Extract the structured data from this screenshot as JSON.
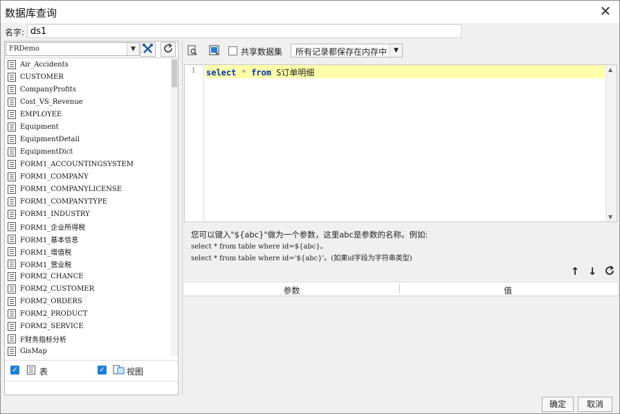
{
  "window": {
    "title": "数据库查询",
    "close_glyph": "✕"
  },
  "name_field": {
    "label": "名字:",
    "value": "ds1"
  },
  "left_panel": {
    "connection": "FRDemo",
    "tables": [
      "Air_Accidents",
      "CUSTOMER",
      "CompanyProfits",
      "Cost_VS_Revenue",
      "EMPLOYEE",
      "Equipment",
      "EquipmentDetail",
      "EquipmentDict",
      "FORM1_ACCOUNTINGSYSTEM",
      "FORM1_COMPANY",
      "FORM1_COMPANYLICENSE",
      "FORM1_COMPANYTYPE",
      "FORM1_INDUSTRY",
      "FORM1_企业所得税",
      "FORM1_基本信息",
      "FORM1_增值税",
      "FORM1_营业税",
      "FORM2_CHANCE",
      "FORM2_CUSTOMER",
      "FORM2_ORDERS",
      "FORM2_PRODUCT",
      "FORM2_SERVICE",
      "F财务指标分析",
      "GisMap"
    ],
    "filter_table_label": "表",
    "filter_view_label": "视图"
  },
  "right_panel": {
    "shared_label": "共享数据集",
    "store_option": "所有记录都保存在内存中",
    "line_number": "1",
    "sql": {
      "kw1": "select",
      "star": "*",
      "kw2": "from",
      "table": "S订单明细"
    },
    "hint_line1": "您可以键入\"${abc}\"做为一个参数，这里abc是参数的名称。例如:",
    "hint_line2": "select * from table where id=${abc}。",
    "hint_line3": "select * from table where id='${abc}'。(如果id字段为字符串类型)",
    "param_col": "参数",
    "value_col": "值"
  },
  "buttons": {
    "ok": "确定",
    "cancel": "取消"
  }
}
